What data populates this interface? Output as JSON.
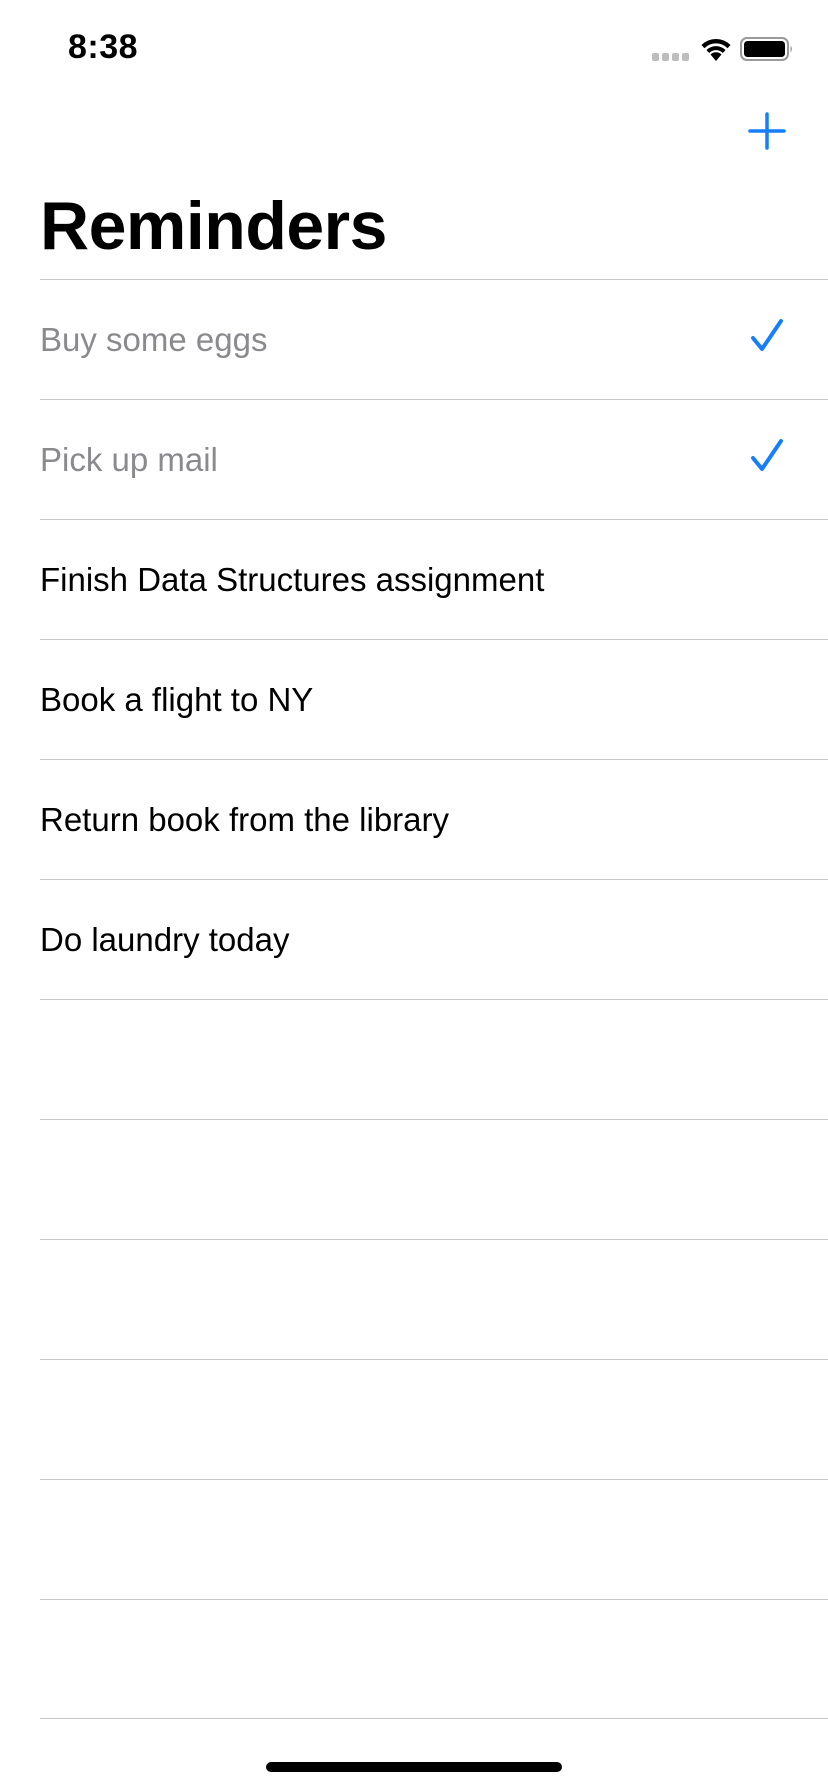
{
  "status_bar": {
    "time": "8:38"
  },
  "nav": {
    "title": "Reminders",
    "add_icon": "plus-icon"
  },
  "colors": {
    "accent": "#157efb",
    "completed_text": "#8a8a8e",
    "separator": "#c8c7cc"
  },
  "reminders": [
    {
      "label": "Buy some eggs",
      "completed": true
    },
    {
      "label": "Pick up mail",
      "completed": true
    },
    {
      "label": "Finish Data Structures assignment",
      "completed": false
    },
    {
      "label": "Book a flight to NY",
      "completed": false
    },
    {
      "label": "Return book from the library",
      "completed": false
    },
    {
      "label": "Do laundry today",
      "completed": false
    },
    {
      "label": "",
      "completed": false
    },
    {
      "label": "",
      "completed": false
    },
    {
      "label": "",
      "completed": false
    },
    {
      "label": "",
      "completed": false
    },
    {
      "label": "",
      "completed": false
    },
    {
      "label": "",
      "completed": false
    }
  ]
}
